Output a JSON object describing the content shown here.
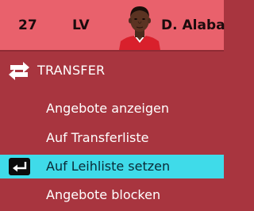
{
  "player": {
    "number": "27",
    "position": "LV",
    "name": "D. Alaba"
  },
  "section": {
    "title": "TRANSFER",
    "icon": "transfer-arrows-icon"
  },
  "menu": {
    "items": [
      {
        "label": "Angebote anzeigen",
        "selected": false
      },
      {
        "label": "Auf Transferliste",
        "selected": false
      },
      {
        "label": "Auf Leihliste setzen",
        "selected": true,
        "icon": "enter-key-icon"
      },
      {
        "label": "Angebote blocken",
        "selected": false
      }
    ]
  },
  "colors": {
    "player_bar": "#e9616c",
    "menu_background": "#a8353f",
    "selection_highlight": "#3fdbe9",
    "text": "#ffffff"
  }
}
